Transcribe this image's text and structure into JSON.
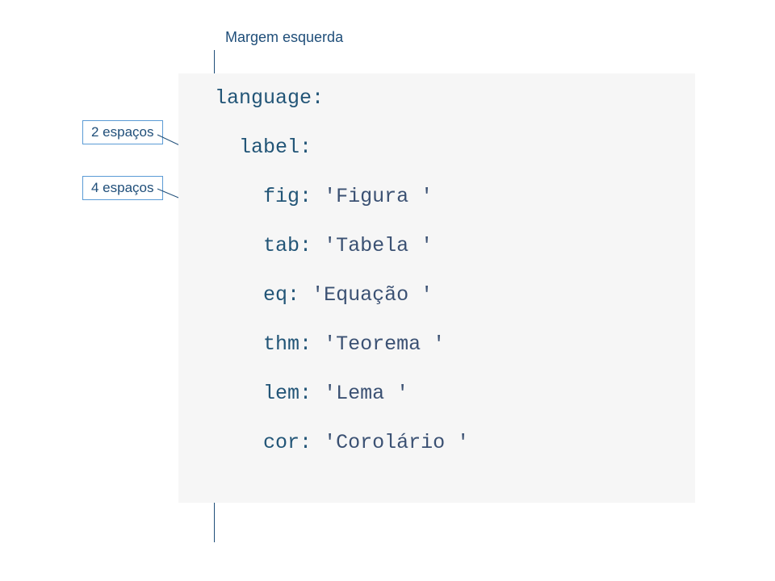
{
  "margin_label": "Margem esquerda",
  "annotations": {
    "two_spaces": "2 espaços",
    "four_spaces": "4 espaços"
  },
  "code": {
    "language_key": "language",
    "label_key": "label",
    "items": [
      {
        "key": "fig",
        "value": "'Figura '"
      },
      {
        "key": "tab",
        "value": "'Tabela '"
      },
      {
        "key": "eq",
        "value": "'Equação '"
      },
      {
        "key": "thm",
        "value": "'Teorema '"
      },
      {
        "key": "lem",
        "value": "'Lema '"
      },
      {
        "key": "cor",
        "value": "'Corolário '"
      }
    ]
  }
}
